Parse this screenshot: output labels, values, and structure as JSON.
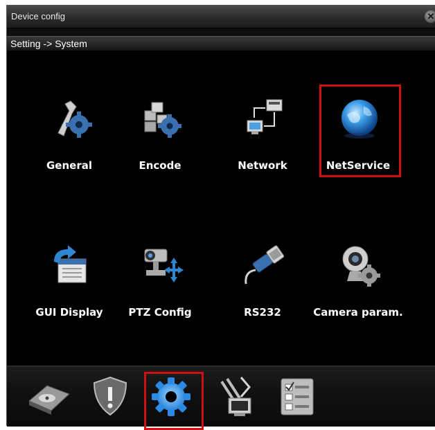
{
  "window": {
    "title": "Device config",
    "close_symbol": "✕"
  },
  "breadcrumb": {
    "text": "Setting -> System"
  },
  "menu": {
    "items": [
      {
        "label": "General",
        "icon": "wrench-gear-icon"
      },
      {
        "label": "Encode",
        "icon": "blocks-gear-icon"
      },
      {
        "label": "Network",
        "icon": "network-computers-icon"
      },
      {
        "label": "NetService",
        "icon": "globe-icon",
        "highlighted": true
      },
      {
        "label": "GUI Display",
        "icon": "display-arrow-icon"
      },
      {
        "label": "PTZ Config",
        "icon": "ptz-camera-icon"
      },
      {
        "label": "RS232",
        "icon": "serial-cable-icon"
      },
      {
        "label": "Camera param.",
        "icon": "webcam-gear-icon"
      }
    ]
  },
  "toolbar": {
    "items": [
      {
        "icon": "hard-disk-icon"
      },
      {
        "icon": "shield-alert-icon"
      },
      {
        "icon": "settings-gear-icon",
        "highlighted": true
      },
      {
        "icon": "tools-monitor-icon"
      },
      {
        "icon": "checklist-icon"
      }
    ]
  },
  "colors": {
    "highlight": "#d01010",
    "background": "#000000",
    "text": "#ffffff"
  }
}
